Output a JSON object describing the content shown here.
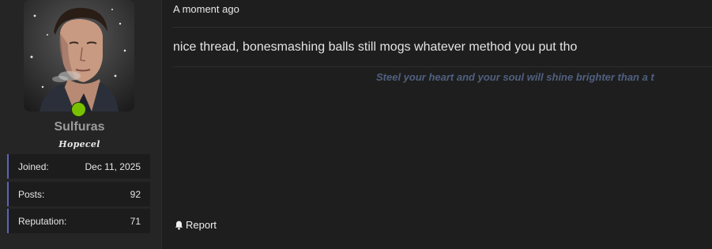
{
  "user": {
    "name": "Sulfuras",
    "title": "Hopecel",
    "online_color": "#79c100",
    "stats": [
      {
        "label": "Joined:",
        "value": "Dec 11, 2025"
      },
      {
        "label": "Posts:",
        "value": "92"
      },
      {
        "label": "Reputation:",
        "value": "71"
      }
    ]
  },
  "post": {
    "time": "A moment ago",
    "body": "nice thread, bonesmashing balls still mogs whatever method you put tho",
    "signature": "Steel your heart and your soul will shine brighter than a t",
    "report_label": "Report"
  },
  "icons": {
    "report": "bell-icon"
  },
  "colors": {
    "stat_accent": "#5a66b8",
    "signature": "#50607f"
  }
}
